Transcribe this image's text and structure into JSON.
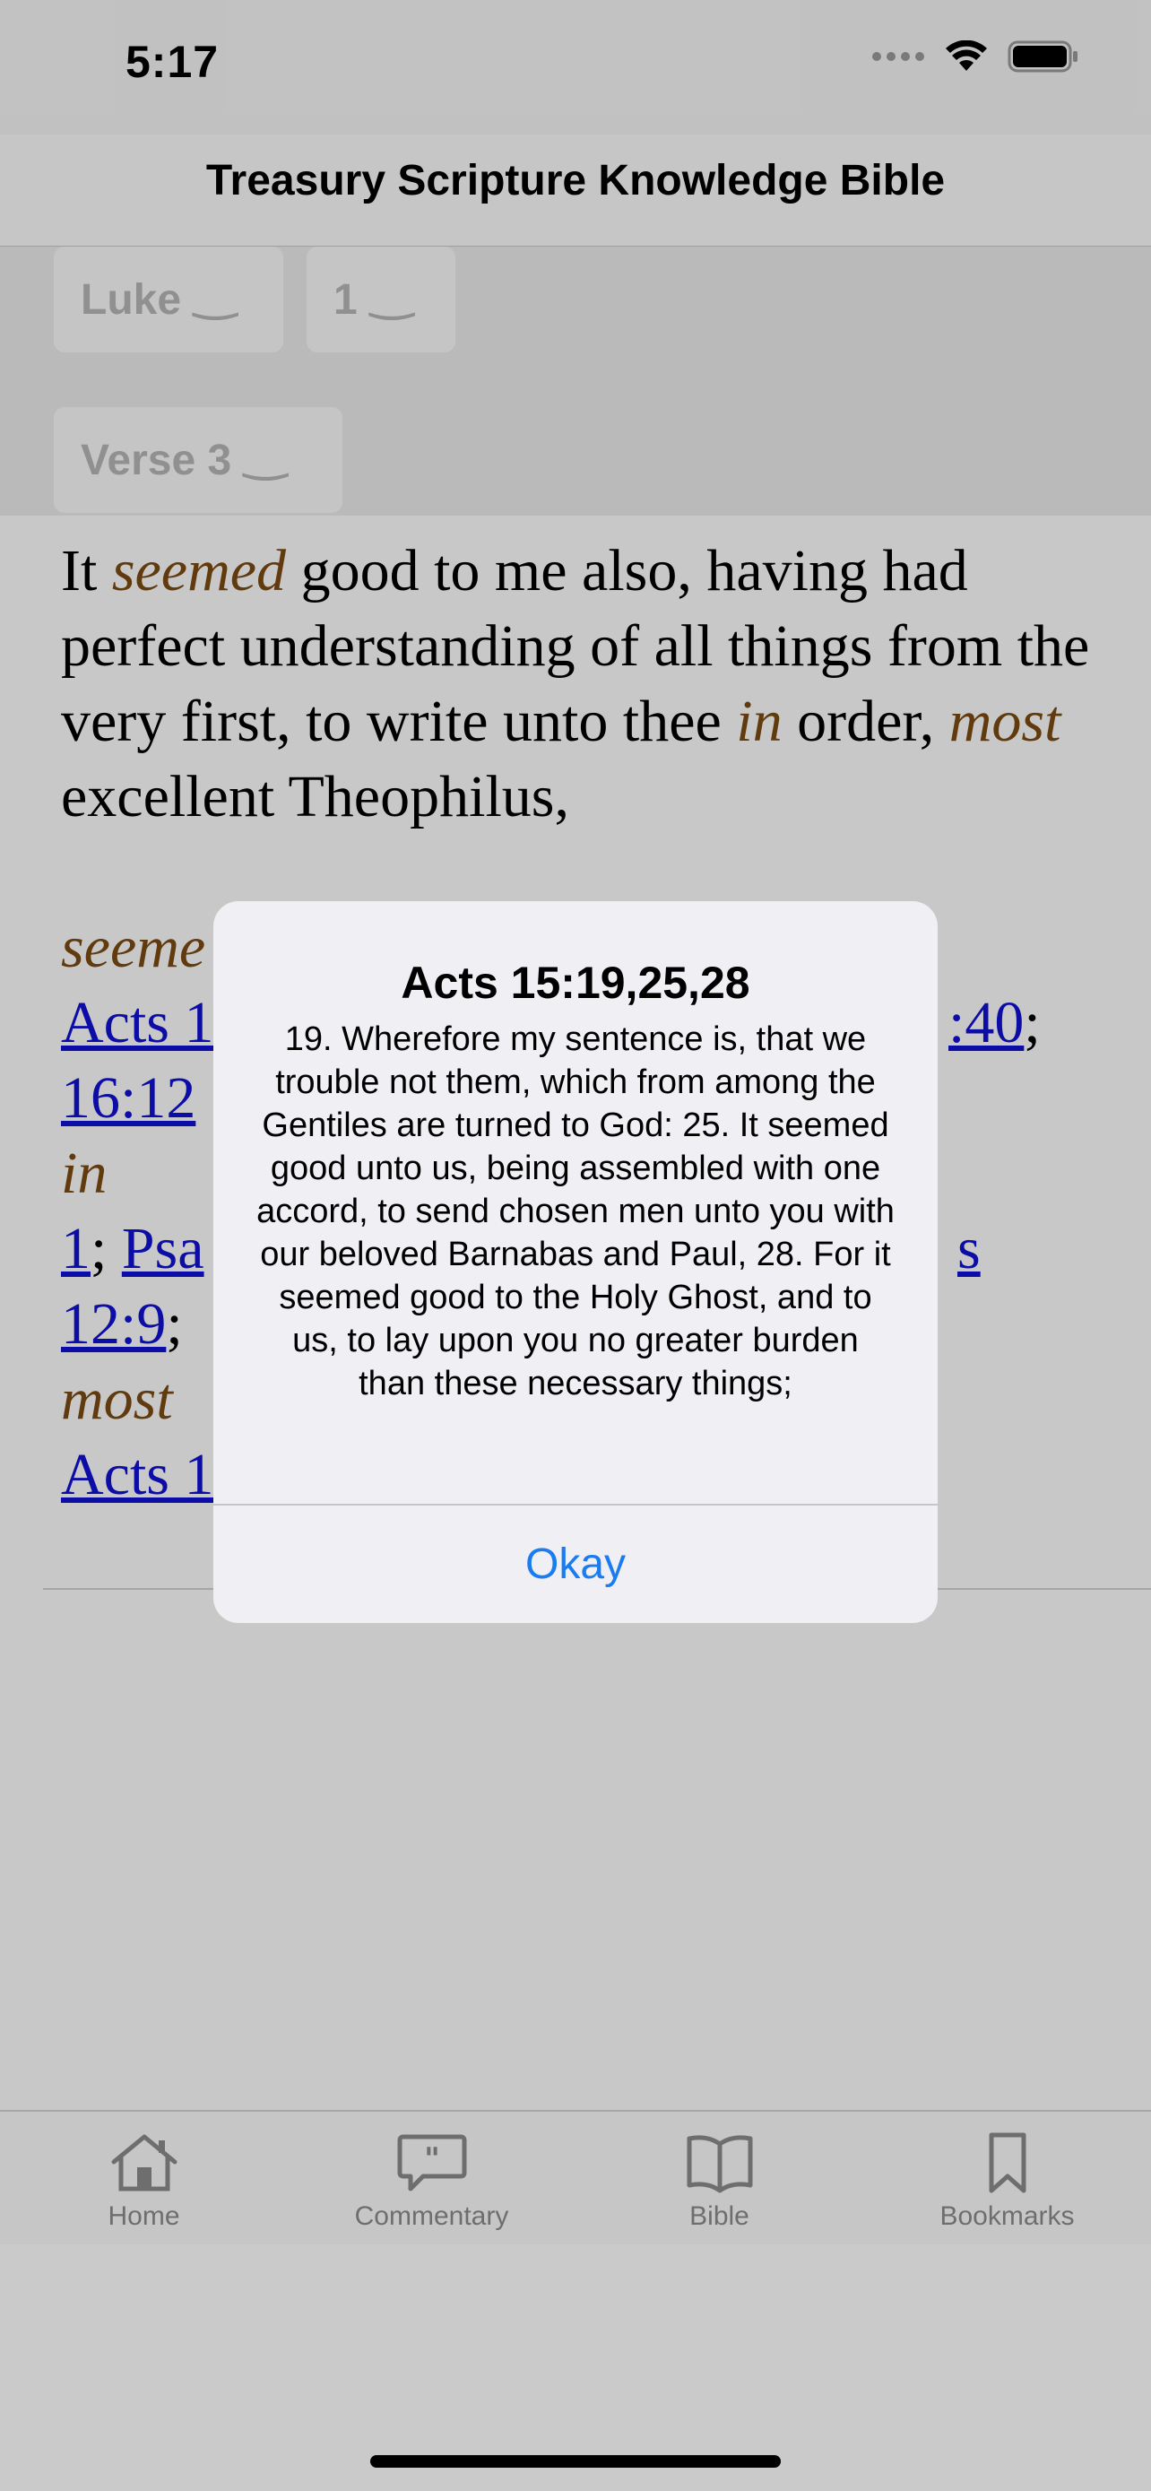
{
  "status": {
    "time": "5:17"
  },
  "navbar": {
    "title": "Treasury Scripture Knowledge Bible"
  },
  "pickers": {
    "book": "Luke",
    "chapter": "1",
    "verse": "Verse 3"
  },
  "verse": {
    "t1": "It ",
    "w1": "seemed",
    "t2": " good to me also, having had perfect understanding of all things from the very first, to write unto thee ",
    "w2": "in",
    "t3": " order, ",
    "w3": "most",
    "t4": " excellent Theophilus,"
  },
  "refs": {
    "h1": "seeme",
    "r1a": "Acts 1",
    "r1b": ":40",
    "sep1": ";",
    "r2": "16:12",
    "h2": "in",
    "r3": "1",
    "sep3": "; ",
    "r4": "Psa",
    "r5": "s",
    "r6": "12:9",
    "sep6": "; ",
    "h3": "most",
    "r7": "Acts 1"
  },
  "alert": {
    "title": "Acts 15:19,25,28",
    "message": "19. Wherefore my sentence is, that we trouble not them, which from among the Gentiles are turned to God: 25. It seemed good unto us, being assembled with one accord, to send chosen men unto you with our beloved Barnabas and Paul, 28. For it seemed good to the Holy Ghost, and to us, to lay upon you no greater burden than these necessary things;",
    "button": "Okay"
  },
  "tabs": [
    {
      "label": "Home",
      "icon": "house-icon"
    },
    {
      "label": "Commentary",
      "icon": "quote-bubble-icon"
    },
    {
      "label": "Bible",
      "icon": "book-icon"
    },
    {
      "label": "Bookmarks",
      "icon": "bookmark-icon"
    }
  ],
  "colors": {
    "accent": "#1a7cf0",
    "highlight": "#7a4a12",
    "link": "#1010d0"
  }
}
